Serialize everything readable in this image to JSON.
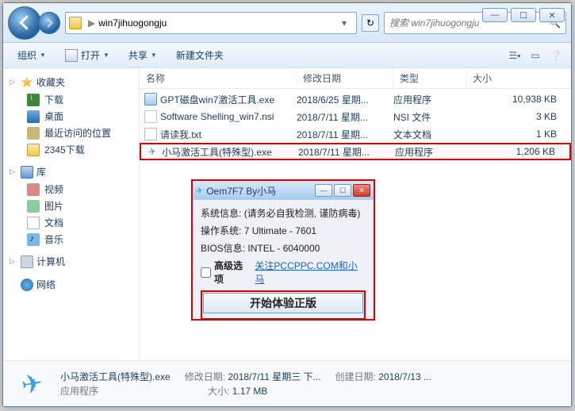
{
  "window_controls": {
    "min": "—",
    "max": "☐",
    "close": "✕"
  },
  "address": {
    "folder": "win7jihuogongju",
    "sep": "▶"
  },
  "search": {
    "placeholder": "搜索 win7jihuogongju"
  },
  "toolbar": {
    "organize": "组织",
    "open": "打开",
    "share": "共享",
    "newfolder": "新建文件夹"
  },
  "sidebar": {
    "favorites": {
      "title": "收藏夹",
      "items": [
        "下载",
        "桌面",
        "最近访问的位置",
        "2345下载"
      ]
    },
    "library": {
      "title": "库",
      "items": [
        "视频",
        "图片",
        "文档",
        "音乐"
      ]
    },
    "computer": "计算机",
    "network": "网络"
  },
  "columns": {
    "name": "名称",
    "date": "修改日期",
    "type": "类型",
    "size": "大小"
  },
  "files": [
    {
      "name": "GPT磁盘win7激活工具.exe",
      "date": "2018/6/25 星期...",
      "type": "应用程序",
      "size": "10,938 KB",
      "icon": "exe"
    },
    {
      "name": "Software Shelling_win7.nsi",
      "date": "2018/7/11 星期...",
      "type": "NSI 文件",
      "size": "3 KB",
      "icon": "nsi"
    },
    {
      "name": "请读我.txt",
      "date": "2018/7/11 星期...",
      "type": "文本文档",
      "size": "1 KB",
      "icon": "txt"
    },
    {
      "name": "小马激活工具(特殊型).exe",
      "date": "2018/7/11 星期...",
      "type": "应用程序",
      "size": "1,206 KB",
      "icon": "exe2"
    }
  ],
  "status": {
    "filename": "小马激活工具(特殊型).exe",
    "filetype": "应用程序",
    "mdate_label": "修改日期:",
    "mdate": "2018/7/11 星期三 下...",
    "cdate_label": "创建日期:",
    "cdate": "2018/7/13 ...",
    "size_label": "大小:",
    "size": "1.17 MB"
  },
  "dialog": {
    "title": "Oem7F7 By小马",
    "sysinfo_label": "系统信息:",
    "sysinfo": "(请务必自我检测, 谨防病毒)",
    "os_label": "操作系统:",
    "os": "7 Ultimate - 7601",
    "bios_label": "BIOS信息:",
    "bios": "INTEL  - 6040000",
    "adv": "高级选项",
    "link": "关注PCCPPC.COM和小马",
    "button": "开始体验正版"
  }
}
